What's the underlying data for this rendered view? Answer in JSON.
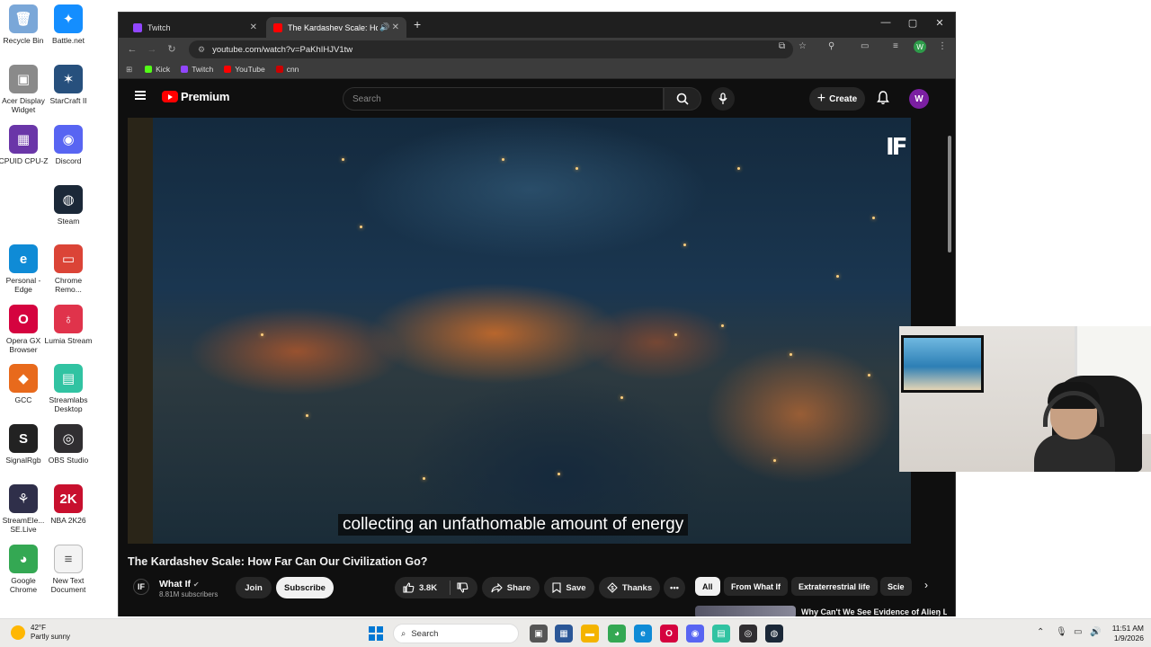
{
  "desktop": {
    "icons": [
      {
        "label": "Recycle Bin",
        "icon": "recycle-bin-icon",
        "color": "#7aa7d8",
        "glyph": "🗑"
      },
      {
        "label": "Battle.net",
        "icon": "battlenet-icon",
        "color": "#148eff",
        "glyph": "✦"
      },
      {
        "label": "Acer Display Widget",
        "icon": "acer-display-widget-icon",
        "color": "#8a8a8a",
        "glyph": "▣"
      },
      {
        "label": "StarCraft II",
        "icon": "starcraft-icon",
        "color": "#27507d",
        "glyph": "✶"
      },
      {
        "label": "CPUID CPU-Z",
        "icon": "cpuz-icon",
        "color": "#6a36a8",
        "glyph": "▦"
      },
      {
        "label": "Discord",
        "icon": "discord-icon",
        "color": "#5865f2",
        "glyph": "◉"
      },
      {
        "label": "Steam",
        "icon": "steam-icon",
        "color": "#1b2838",
        "glyph": "◍"
      },
      {
        "label": "Personal - Edge",
        "icon": "edge-icon",
        "color": "#0f8bd6",
        "glyph": "e"
      },
      {
        "label": "Chrome Remo...",
        "icon": "chrome-remote-icon",
        "color": "#db4437",
        "glyph": "▭"
      },
      {
        "label": "Opera GX Browser",
        "icon": "opera-gx-icon",
        "color": "#d5033f",
        "glyph": "O"
      },
      {
        "label": "Lumia Stream",
        "icon": "lumia-stream-icon",
        "color": "#e0334b",
        "glyph": "♁"
      },
      {
        "label": "GCC",
        "icon": "gcc-icon",
        "color": "#e86a1c",
        "glyph": "◆"
      },
      {
        "label": "Streamlabs Desktop",
        "icon": "streamlabs-icon",
        "color": "#31c3a2",
        "glyph": "▤"
      },
      {
        "label": "SignalRgb",
        "icon": "signalrgb-icon",
        "color": "#222222",
        "glyph": "S"
      },
      {
        "label": "OBS Studio",
        "icon": "obs-icon",
        "color": "#302e31",
        "glyph": "◎"
      },
      {
        "label": "StreamEle... SE.Live",
        "icon": "streamelements-icon",
        "color": "#2f2f4a",
        "glyph": "⚘"
      },
      {
        "label": "NBA 2K26",
        "icon": "nba2k-icon",
        "color": "#c8102e",
        "glyph": "2K"
      },
      {
        "label": "Google Chrome",
        "icon": "chrome-icon",
        "color": "#34a853",
        "glyph": "◕"
      },
      {
        "label": "New Text Document",
        "icon": "text-document-icon",
        "color": "#f3f3f3",
        "glyph": "≡"
      }
    ]
  },
  "browser": {
    "tabs": [
      {
        "label": "Twitch",
        "icon": "twitch-icon",
        "color": "#9146ff",
        "active": false
      },
      {
        "label": "The Kardashev Scale: How F",
        "icon": "youtube-icon",
        "color": "#ff0000",
        "active": true
      }
    ],
    "new_tab": "+",
    "url": "youtube.com/watch?v=PaKhIHJV1tw",
    "bookmarks": [
      {
        "label": "Kick",
        "icon": "kick-icon",
        "color": "#53fc18"
      },
      {
        "label": "Twitch",
        "icon": "twitch-icon",
        "color": "#9146ff"
      },
      {
        "label": "YouTube",
        "icon": "youtube-icon",
        "color": "#ff0000"
      },
      {
        "label": "cnn",
        "icon": "cnn-icon",
        "color": "#cc0000"
      }
    ],
    "profile_initial": "W"
  },
  "youtube": {
    "logo_text": "Premium",
    "search_placeholder": "Search",
    "create_label": "Create",
    "avatar_initial": "W",
    "caption": "collecting an unfathomable amount of energy",
    "channel_watermark": "IF",
    "video_title": "The Kardashev Scale: How Far Can Our Civilization Go?",
    "channel": {
      "name": "What If",
      "subscribers": "8.81M subscribers",
      "avatar": "IF"
    },
    "buttons": {
      "join": "Join",
      "subscribe": "Subscribe",
      "likes": "3.8K",
      "share": "Share",
      "save": "Save",
      "thanks": "Thanks"
    },
    "chips": [
      "All",
      "From What If",
      "Extraterrestrial life",
      "Scie"
    ],
    "recommendation": {
      "title": "Why Can't We See Evidence of Alien Life? | Documentary"
    }
  },
  "taskbar": {
    "weather_temp": "42°F",
    "weather_desc": "Partly sunny",
    "search_label": "Search",
    "time": "11:51 AM",
    "date": "1/9/2026"
  }
}
